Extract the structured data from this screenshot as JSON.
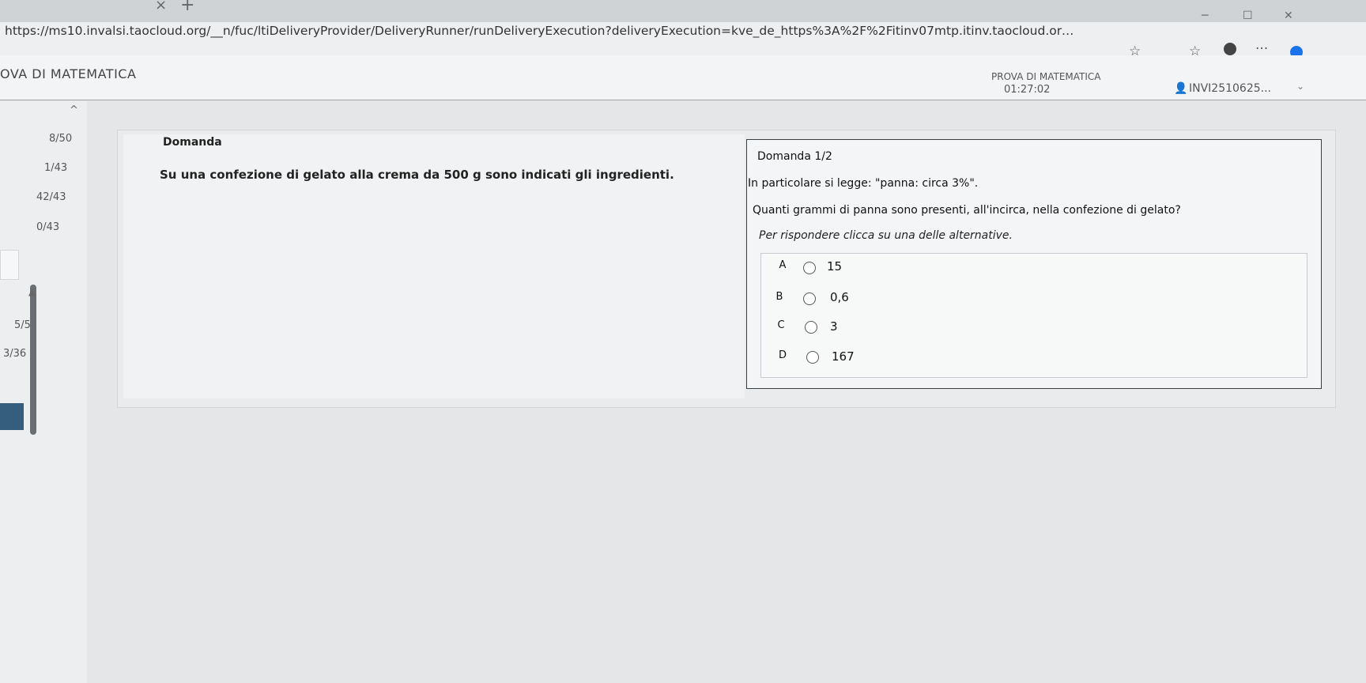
{
  "browser": {
    "url": "https://ms10.invalsi.taocloud.org/__n/fuc/ltiDeliveryProvider/DeliveryRunner/runDeliveryExecution?deliveryExecution=kve_de_https%3A%2F%2Fitinv07mtp.itinv.taocloud.org%2F%23i682c374e31d0e..."
  },
  "header": {
    "app_title": "OVA DI MATEMATICA",
    "test_name": "PROVA DI MATEMATICA",
    "timer": "01:27:02",
    "user_name": "INVI2510625..."
  },
  "nav": {
    "items": [
      "8/50",
      "1/43",
      "42/43",
      "0/43",
      "5/5",
      "3/36"
    ]
  },
  "stimulus": {
    "heading": "Domanda",
    "text": "Su una confezione di gelato alla crema da 500 g sono indicati gli ingredienti."
  },
  "question": {
    "count": "Domanda 1/2",
    "line1": "In particolare si legge: \"panna: circa 3%\".",
    "line2": "Quanti grammi di panna sono presenti, all'incirca, nella confezione di gelato?",
    "instruction": "Per rispondere clicca su una delle alternative.",
    "choices": [
      {
        "letter": "A",
        "value": "15"
      },
      {
        "letter": "B",
        "value": "0,6"
      },
      {
        "letter": "C",
        "value": "3"
      },
      {
        "letter": "D",
        "value": "167"
      }
    ]
  }
}
